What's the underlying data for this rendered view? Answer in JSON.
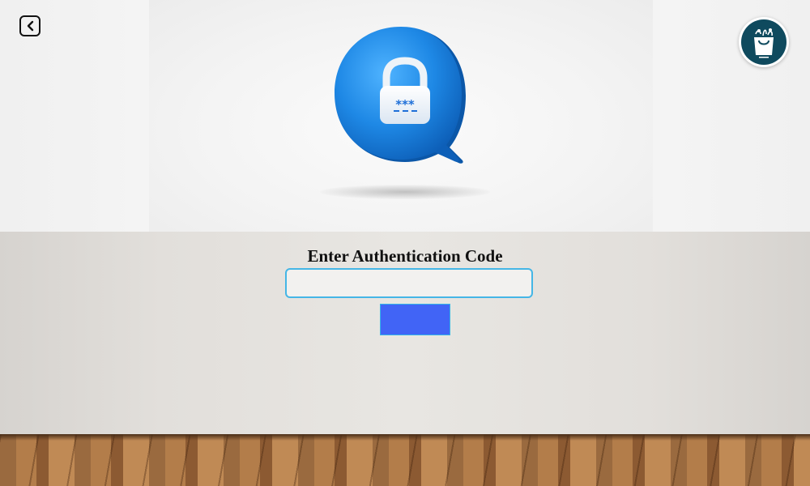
{
  "header": {
    "back_icon": "chevron-left-icon",
    "logo_icon": "shopping-bag-logo"
  },
  "hero": {
    "illustration_icon": "lock-chat-bubble-icon",
    "accent": "#1e88e5"
  },
  "auth": {
    "title": "Enter Authentication Code",
    "code_value": "",
    "code_placeholder": "",
    "submit_label": ""
  },
  "colors": {
    "input_border": "#45b6e6",
    "button_bg": "#4164f6",
    "logo_bg": "#0f4a5e"
  }
}
